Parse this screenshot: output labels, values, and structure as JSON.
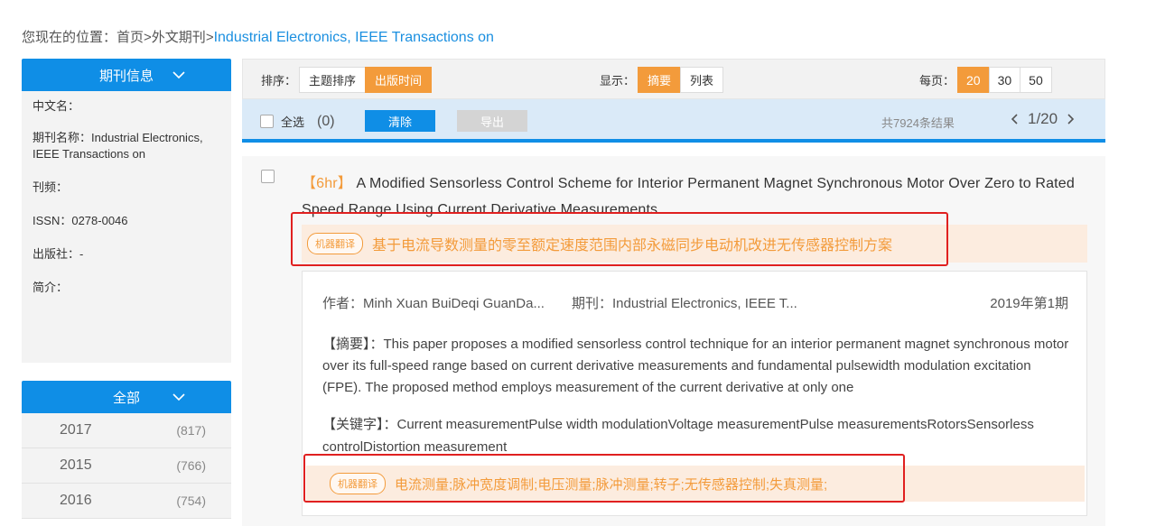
{
  "breadcrumb": {
    "prefix": "您现在的位置：",
    "home": "首页",
    "sep1": ">",
    "section": "外文期刊",
    "sep2": ">",
    "current": "Industrial Electronics, IEEE Transactions on"
  },
  "sidebar": {
    "journal_info_title": "期刊信息",
    "info": {
      "cn_name": "中文名：",
      "journal_name": "期刊名称：Industrial Electronics, IEEE Transactions on",
      "frequency": "刊频：",
      "issn": "ISSN：0278-0046",
      "publisher": "出版社：-",
      "intro": "简介："
    },
    "years_title": "全部",
    "years": [
      {
        "year": "2017",
        "count": "(817)"
      },
      {
        "year": "2015",
        "count": "(766)"
      },
      {
        "year": "2016",
        "count": "(754)"
      }
    ]
  },
  "toolbar": {
    "sort_label": "排序：",
    "sort_options": [
      "主题排序",
      "出版时间"
    ],
    "sort_active": "出版时间",
    "display_label": "显示：",
    "display_options": [
      "摘要",
      "列表"
    ],
    "display_active": "摘要",
    "per_page_label": "每页：",
    "per_page_options": [
      "20",
      "30",
      "50"
    ],
    "per_page_active": "20"
  },
  "selectbar": {
    "select_all": "全选",
    "selected_count": "(0)",
    "clear": "清除",
    "export": "导出",
    "total": "共7924条结果",
    "page": "1/20"
  },
  "result": {
    "tag": "【6hr】",
    "title": "A Modified Sensorless Control Scheme for Interior Permanent Magnet Synchronous Motor Over Zero to Rated Speed Range Using Current Derivative Measurements",
    "mt_badge": "机器翻译",
    "title_translation": "基于电流导数测量的零至额定速度范围内部永磁同步电动机改进无传感器控制方案",
    "author": "作者：Minh Xuan BuiDeqi GuanDa...",
    "journal": "期刊：Industrial Electronics, IEEE T...",
    "issue": "2019年第1期",
    "abstract": "【摘要】：This paper proposes a modified sensorless control technique for an interior permanent magnet synchronous motor over its full-speed range based on current derivative measurements and fundamental pulsewidth modulation excitation (FPE). The proposed method employs measurement of the current derivative at only one",
    "keywords": "【关键字】：Current measurementPulse width modulationVoltage measurementPulse measurementsRotorsSensorless controlDistortion measurement",
    "keywords_translation": "电流测量;脉冲宽度调制;电压测量;脉冲测量;转子;无传感器控制;失真测量;"
  },
  "colors": {
    "primary_blue": "#0f8ee6",
    "accent_orange": "#f39b3b",
    "highlight_red": "#e02020"
  }
}
